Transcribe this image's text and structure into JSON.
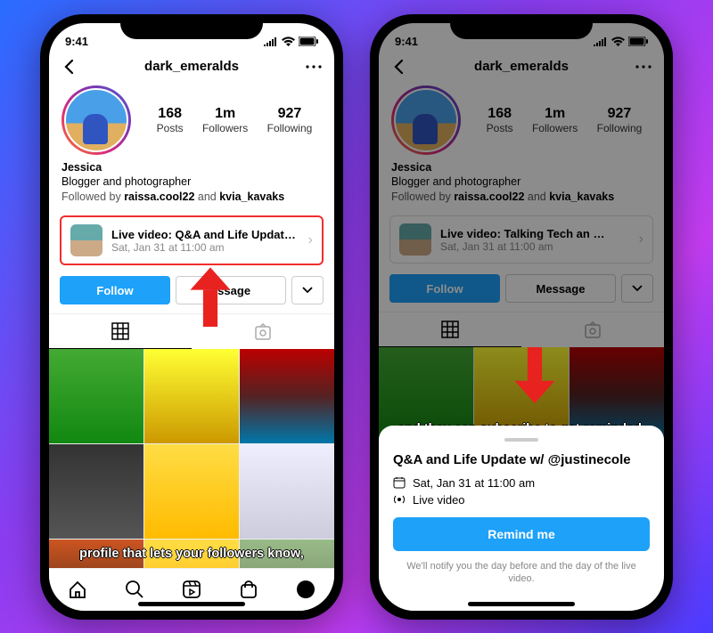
{
  "statusbar": {
    "time": "9:41"
  },
  "header": {
    "username": "dark_emeralds"
  },
  "stats": {
    "posts_num": "168",
    "posts_label": "Posts",
    "followers_num": "1m",
    "followers_label": "Followers",
    "following_num": "927",
    "following_label": "Following"
  },
  "bio": {
    "name": "Jessica",
    "line1": "Blogger and photographer",
    "followed_prefix": "Followed by ",
    "followed_1": "raissa.cool22",
    "followed_and": " and ",
    "followed_2": "kvia_kavaks"
  },
  "live_left": {
    "title": "Live video: Q&A and Life Updat…",
    "date": "Sat, Jan 31 at 11:00 am"
  },
  "live_right": {
    "title": "Live video: Talking Tech an …",
    "date": "Sat, Jan 31 at 11:00 am"
  },
  "actions": {
    "follow": "Follow",
    "message_left": "essage",
    "message_right": "Message"
  },
  "caption_left": "profile that lets your followers know,",
  "caption_right": "and they can subscribe to get reminded.",
  "sheet": {
    "title": "Q&A and Life Update w/ @justinecole",
    "date": "Sat, Jan 31 at 11:00 am",
    "type": "Live video",
    "remind": "Remind me",
    "note": "We'll notify you the day before and the day of the live video."
  }
}
